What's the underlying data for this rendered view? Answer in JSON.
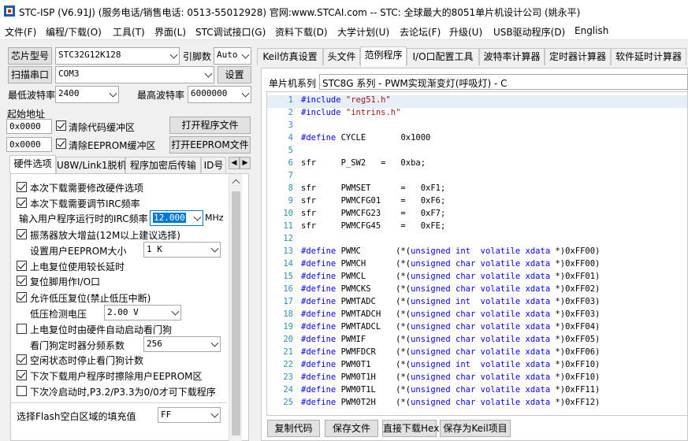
{
  "window": {
    "title": "STC-ISP (V6.91J) (服务电话/销售电话: 0513-55012928) 官网:www.STCAI.com  -- STC: 全球最大的8051单片机设计公司 (姚永平)"
  },
  "menu": [
    "文件(F)",
    "编程/下载(O)",
    "工具(T)",
    "界面(L)",
    "STC调试接口(G)",
    "资料下载(D)",
    "大学计划(U)",
    "去论坛(F)",
    "升级(U)",
    "USB驱动程序(D)",
    "English"
  ],
  "left": {
    "chip_label": "芯片型号",
    "chip_value": "STC32G12K128",
    "cipher_label": "引脚数",
    "cipher_value": "Auto",
    "scan_button": "扫描串口",
    "port_value": "COM3",
    "settings_button": "设置",
    "min_baud_label": "最低波特率",
    "min_baud_value": "2400",
    "max_baud_label": "最高波特率",
    "max_baud_value": "6000000",
    "start_addr_label": "起始地址",
    "addr1": "0x0000",
    "clear_code_label": "清除代码缓冲区",
    "open_program_button": "打开程序文件",
    "addr2": "0x0000",
    "clear_eeprom_label": "清除EEPROM缓冲区",
    "open_eeprom_button": "打开EEPROM文件",
    "tabs": [
      "硬件选项",
      "U8W/Link1脱机",
      "程序加密后传输",
      "ID号"
    ],
    "options": {
      "opt1": "本次下载需要修改硬件选项",
      "opt2": "本次下载需要调节IRC频率",
      "irc_label": "输入用户程序运行时的IRC频率",
      "irc_value": "12.000",
      "irc_unit": "MHz",
      "opt3": "振荡器放大增益(12M以上建议选择)",
      "eeprom_size_label": "设置用户EEPROM大小",
      "eeprom_size_value": "1   K",
      "opt4": "上电复位使用较长延时",
      "opt5": "复位脚用作I/O口",
      "opt6": "允许低压复位(禁止低压中断)",
      "lvd_label": "低压检测电压",
      "lvd_value": "2.00 V",
      "opt7": "上电复位时由硬件自动启动看门狗",
      "wdt_label": "看门狗定时器分频系数",
      "wdt_value": "256",
      "opt8": "空闲状态时停止看门狗计数",
      "opt9": "下次下载用户程序时擦除用户EEPROM区",
      "opt10": "下次冷启动时,P3.2/P3.3为0/0才可下载程序",
      "flash_fill_label": "选择Flash空白区域的填充值",
      "flash_fill_value": "FF"
    }
  },
  "right": {
    "tabs": [
      "Keil仿真设置",
      "头文件",
      "范例程序",
      "I/O口配置工具",
      "波特率计算器",
      "定时器计算器",
      "软件延时计算器"
    ],
    "mcu_series_label": "单片机系列",
    "mcu_series_value": "STC8G 系列 - PWM实现渐变灯(呼吸灯) - C",
    "buttons": [
      "复制代码",
      "保存文件",
      "直接下载Hex",
      "保存为Keil项目"
    ],
    "code": [
      {
        "n": "1",
        "t": "#include \"reg51.h\""
      },
      {
        "n": "2",
        "t": "#include \"intrins.h\""
      },
      {
        "n": "3",
        "t": ""
      },
      {
        "n": "4",
        "t": "#define CYCLE       0x1000"
      },
      {
        "n": "5",
        "t": ""
      },
      {
        "n": "6",
        "t": "sfr     P_SW2   =   0xba;"
      },
      {
        "n": "7",
        "t": ""
      },
      {
        "n": "8",
        "t": "sfr     PWMSET      =   0xF1;"
      },
      {
        "n": "9",
        "t": "sfr     PWMCFG01    =   0xF6;"
      },
      {
        "n": "10",
        "t": "sfr     PWMCFG23    =   0xF7;"
      },
      {
        "n": "11",
        "t": "sfr     PWMCFG45    =   0xFE;"
      },
      {
        "n": "12",
        "t": ""
      },
      {
        "n": "13",
        "t": "#define PWMC       (*(unsigned int  volatile xdata *)0xFF00)"
      },
      {
        "n": "14",
        "t": "#define PWMCH      (*(unsigned char volatile xdata *)0xFF00)"
      },
      {
        "n": "15",
        "t": "#define PWMCL      (*(unsigned char volatile xdata *)0xFF01)"
      },
      {
        "n": "16",
        "t": "#define PWMCKS     (*(unsigned char volatile xdata *)0xFF02)"
      },
      {
        "n": "17",
        "t": "#define PWMTADC    (*(unsigned int  volatile xdata *)0xFF03)"
      },
      {
        "n": "18",
        "t": "#define PWMTADCH   (*(unsigned char volatile xdata *)0xFF03)"
      },
      {
        "n": "19",
        "t": "#define PWMTADCL   (*(unsigned char volatile xdata *)0xFF04)"
      },
      {
        "n": "20",
        "t": "#define PWMIF      (*(unsigned char volatile xdata *)0xFF05)"
      },
      {
        "n": "21",
        "t": "#define PWMFDCR    (*(unsigned char volatile xdata *)0xFF06)"
      },
      {
        "n": "22",
        "t": "#define PWM0T1     (*(unsigned int  volatile xdata *)0xFF10)"
      },
      {
        "n": "23",
        "t": "#define PWM0T1H    (*(unsigned char volatile xdata *)0xFF10)"
      },
      {
        "n": "24",
        "t": "#define PWM0T1L    (*(unsigned char volatile xdata *)0xFF11)"
      },
      {
        "n": "25",
        "t": "#define PWM0T2H    (*(unsigned char volatile xdata *)0xFF12)"
      }
    ]
  }
}
